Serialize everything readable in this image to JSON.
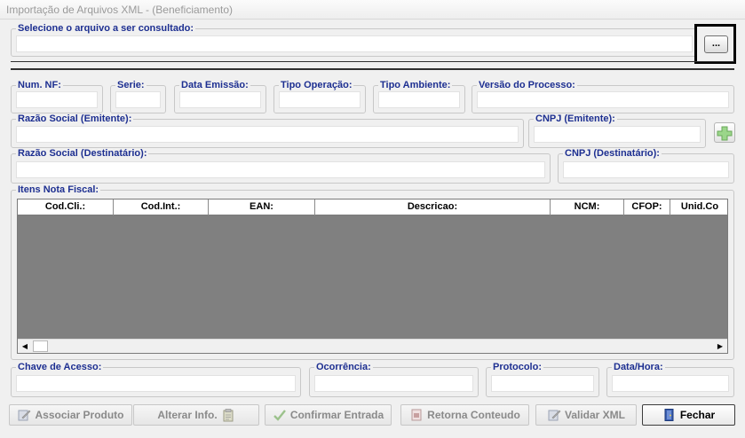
{
  "window": {
    "title": "Importação de Arquivos XML - (Beneficiamento)"
  },
  "file": {
    "label": "Selecione o arquivo a ser consultado:",
    "value": "",
    "browse_label": "..."
  },
  "nf": {
    "num_label": "Num. NF:",
    "serie_label": "Serie:",
    "data_emissao_label": "Data Emissão:",
    "tipo_operacao_label": "Tipo Operação:",
    "tipo_ambiente_label": "Tipo Ambiente:",
    "versao_label": "Versão do Processo:"
  },
  "emitente": {
    "razao_label": "Razão Social (Emitente):",
    "cnpj_label": "CNPJ (Emitente):"
  },
  "destinatario": {
    "razao_label": "Razão Social (Destinatário):",
    "cnpj_label": "CNPJ (Destinatário):"
  },
  "itens": {
    "label": "Itens Nota Fiscal:",
    "columns": [
      "Cod.Cli.:",
      "Cod.Int.:",
      "EAN:",
      "Descricao:",
      "NCM:",
      "CFOP:",
      "Unid.Co"
    ]
  },
  "status": {
    "chave_label": "Chave de Acesso:",
    "ocorrencia_label": "Ocorrência:",
    "protocolo_label": "Protocolo:",
    "data_hora_label": "Data/Hora:"
  },
  "buttons": {
    "associar": "Associar Produto",
    "alterar": "Alterar Info.",
    "confirmar": "Confirmar Entrada",
    "retorna": "Retorna Conteudo",
    "validar": "Validar XML",
    "fechar": "Fechar"
  },
  "icons": {
    "browse": "ellipsis",
    "add": "green-plus-icon",
    "associar": "edit-form-icon",
    "alterar": "clipboard-icon",
    "confirmar": "check-icon",
    "retorna": "document-icon",
    "validar": "edit-form-icon",
    "fechar": "exit-door-icon"
  },
  "colors": {
    "label_text": "#1d2f91",
    "grid_body": "#808080",
    "disabled_text": "#8a8a8a"
  }
}
